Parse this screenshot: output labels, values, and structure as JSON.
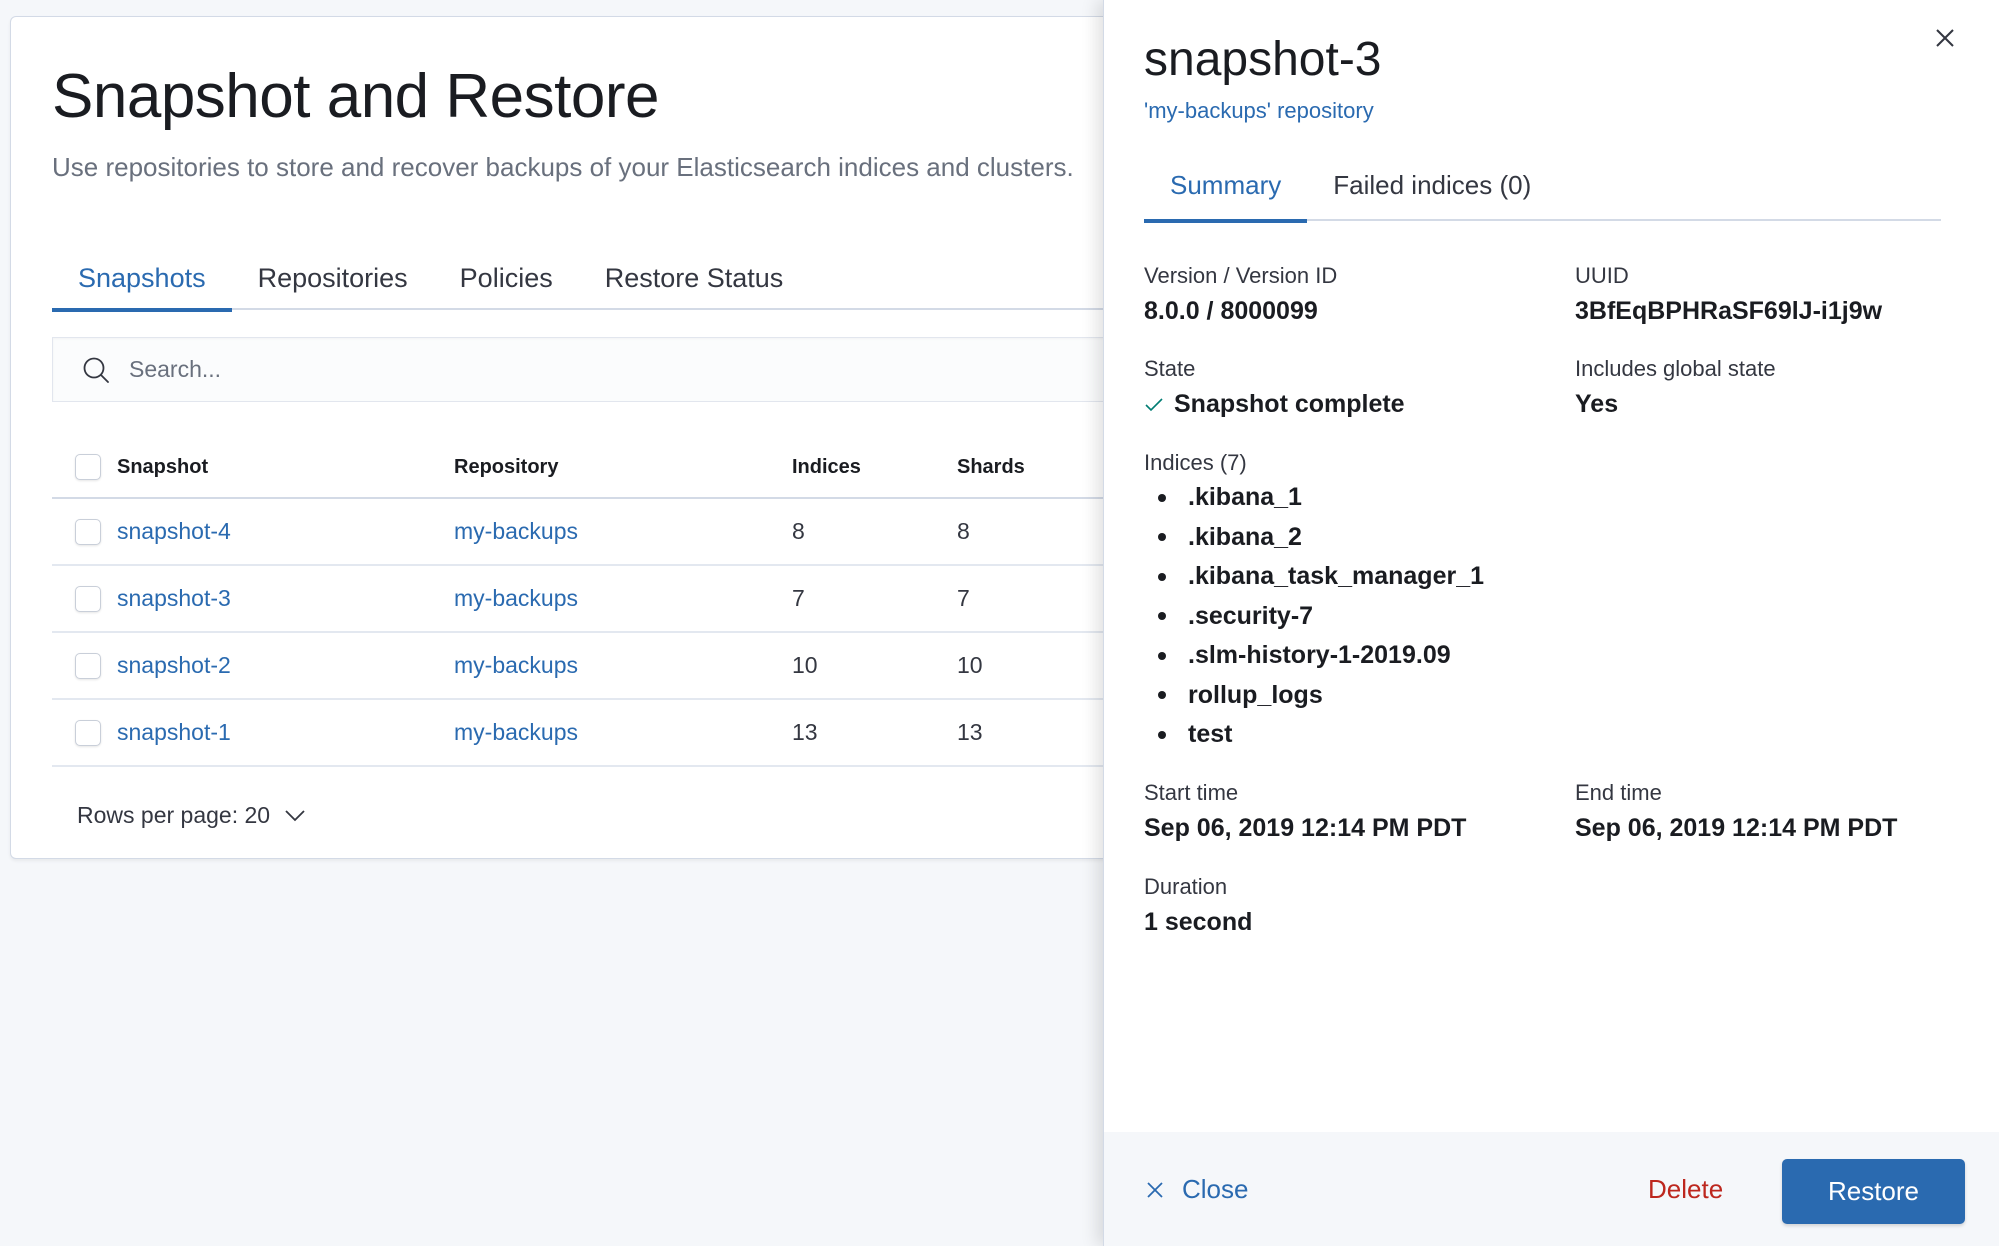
{
  "page": {
    "title": "Snapshot and Restore",
    "description": "Use repositories to store and recover backups of your Elasticsearch indices and clusters.",
    "tabs": [
      {
        "label": "Snapshots",
        "active": true
      },
      {
        "label": "Repositories",
        "active": false
      },
      {
        "label": "Policies",
        "active": false
      },
      {
        "label": "Restore Status",
        "active": false
      }
    ],
    "search": {
      "placeholder": "Search...",
      "value": ""
    }
  },
  "table": {
    "columns": [
      "Snapshot",
      "Repository",
      "Indices",
      "Shards"
    ],
    "rows": [
      {
        "snapshot": "snapshot-4",
        "repository": "my-backups",
        "indices": "8",
        "shards": "8"
      },
      {
        "snapshot": "snapshot-3",
        "repository": "my-backups",
        "indices": "7",
        "shards": "7"
      },
      {
        "snapshot": "snapshot-2",
        "repository": "my-backups",
        "indices": "10",
        "shards": "10"
      },
      {
        "snapshot": "snapshot-1",
        "repository": "my-backups",
        "indices": "13",
        "shards": "13"
      }
    ],
    "rows_per_page_label": "Rows per page: 20"
  },
  "flyout": {
    "title": "snapshot-3",
    "repository_link": "'my-backups' repository",
    "tabs": [
      {
        "label": "Summary",
        "active": true
      },
      {
        "label": "Failed indices (0)",
        "active": false
      }
    ],
    "fields": {
      "version": {
        "label": "Version / Version ID",
        "value": "8.0.0 / 8000099"
      },
      "uuid": {
        "label": "UUID",
        "value": "3BfEqBPHRaSF69lJ-i1j9w"
      },
      "state": {
        "label": "State",
        "value": "Snapshot complete",
        "icon": "check-icon"
      },
      "global_state": {
        "label": "Includes global state",
        "value": "Yes"
      },
      "indices": {
        "label": "Indices (7)",
        "items": [
          ".kibana_1",
          ".kibana_2",
          ".kibana_task_manager_1",
          ".security-7",
          ".slm-history-1-2019.09",
          "rollup_logs",
          "test"
        ]
      },
      "start_time": {
        "label": "Start time",
        "value": "Sep 06, 2019 12:14 PM PDT"
      },
      "end_time": {
        "label": "End time",
        "value": "Sep 06, 2019 12:14 PM PDT"
      },
      "duration": {
        "label": "Duration",
        "value": "1 second"
      }
    },
    "footer": {
      "close_label": "Close",
      "delete_label": "Delete",
      "restore_label": "Restore"
    }
  },
  "colors": {
    "accent": "#2a6ab0",
    "danger": "#bd271e",
    "success": "#017d73",
    "background": "#f5f7fa",
    "text": "#343741"
  }
}
